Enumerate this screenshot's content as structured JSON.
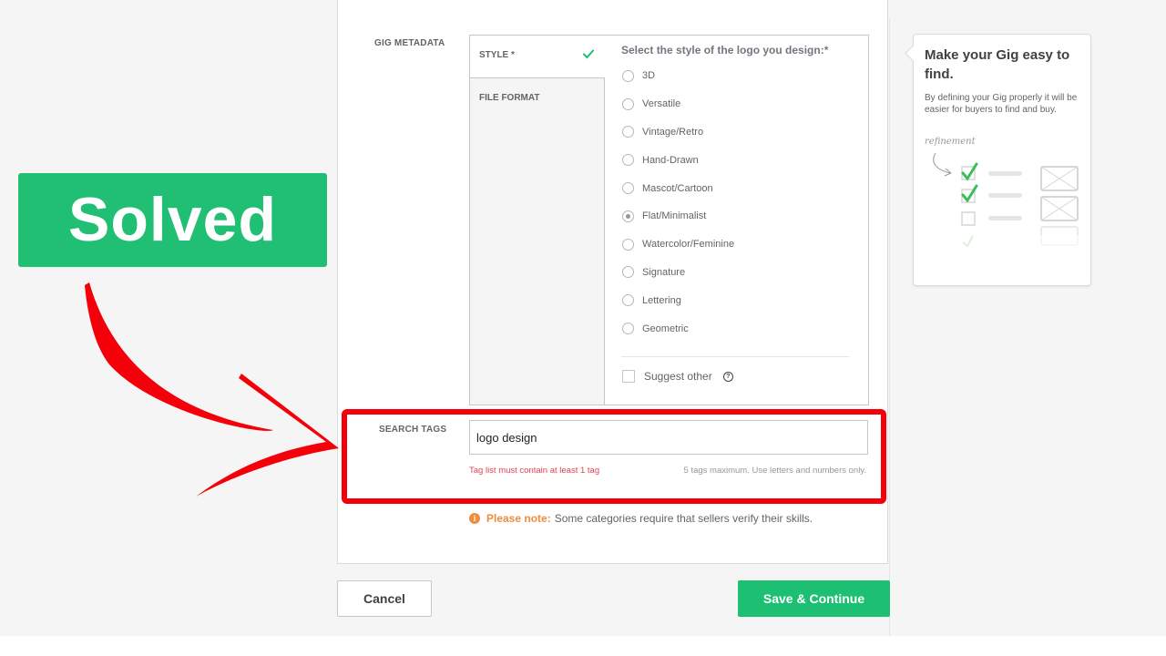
{
  "annotation": {
    "badge_text": "Solved",
    "badge_color": "#21bf73",
    "highlight_color": "#f4000a"
  },
  "form": {
    "gig_metadata": {
      "label": "GIG METADATA",
      "tabs": [
        {
          "label": "STYLE *",
          "active": true,
          "complete": true
        },
        {
          "label": "FILE FORMAT",
          "active": false,
          "complete": false
        }
      ],
      "options_title": "Select the style of the logo you design:*",
      "options": [
        {
          "label": "3D",
          "checked": false
        },
        {
          "label": "Versatile",
          "checked": false
        },
        {
          "label": "Vintage/Retro",
          "checked": false
        },
        {
          "label": "Hand-Drawn",
          "checked": false
        },
        {
          "label": "Mascot/Cartoon",
          "checked": false
        },
        {
          "label": "Flat/Minimalist",
          "checked": true
        },
        {
          "label": "Watercolor/Feminine",
          "checked": false
        },
        {
          "label": "Signature",
          "checked": false
        },
        {
          "label": "Lettering",
          "checked": false
        },
        {
          "label": "Geometric",
          "checked": false
        }
      ],
      "suggest_other_label": "Suggest other",
      "help_icon": "?"
    },
    "search_tags": {
      "label": "SEARCH TAGS",
      "value": "logo design",
      "error": "Tag list must contain at least 1 tag",
      "hint": "5 tags maximum. Use letters and numbers only."
    },
    "note": {
      "icon": "i",
      "strong": "Please note:",
      "text": "Some categories require that sellers verify their skills."
    }
  },
  "buttons": {
    "cancel": "Cancel",
    "save": "Save & Continue"
  },
  "help": {
    "title": "Make your Gig easy to find.",
    "text": "By defining your Gig properly it will be easier for buyers to find and buy.",
    "illustration_label": "refinement"
  },
  "colors": {
    "accent_green": "#1dbf73",
    "error_red": "#e2434f",
    "note_orange": "#ee8d3e"
  }
}
